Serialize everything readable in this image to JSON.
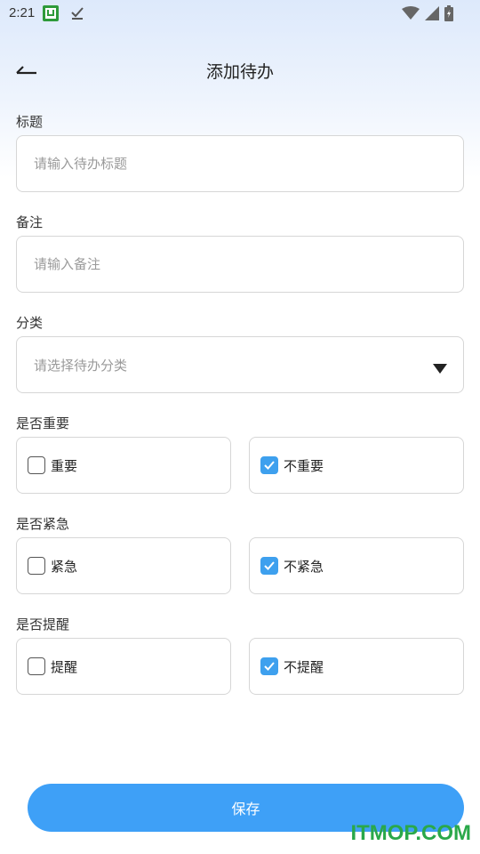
{
  "status_bar": {
    "time": "2:21",
    "notif_badge": "U"
  },
  "header": {
    "title": "添加待办",
    "back_icon": "back-arrow-icon"
  },
  "form": {
    "title_label": "标题",
    "title_placeholder": "请输入待办标题",
    "title_value": "",
    "note_label": "备注",
    "note_placeholder": "请输入备注",
    "note_value": "",
    "category_label": "分类",
    "category_placeholder": "请选择待办分类",
    "important": {
      "label": "是否重要",
      "options": [
        {
          "label": "重要",
          "checked": false
        },
        {
          "label": "不重要",
          "checked": true
        }
      ]
    },
    "urgent": {
      "label": "是否紧急",
      "options": [
        {
          "label": "紧急",
          "checked": false
        },
        {
          "label": "不紧急",
          "checked": true
        }
      ]
    },
    "remind": {
      "label": "是否提醒",
      "options": [
        {
          "label": "提醒",
          "checked": false
        },
        {
          "label": "不提醒",
          "checked": true
        }
      ]
    }
  },
  "actions": {
    "save_label": "保存"
  },
  "watermark": "ITMOP.COM",
  "colors": {
    "accent": "#3ea0f7",
    "checkbox_on": "#3ea0ee",
    "watermark": "#2aa84a"
  }
}
